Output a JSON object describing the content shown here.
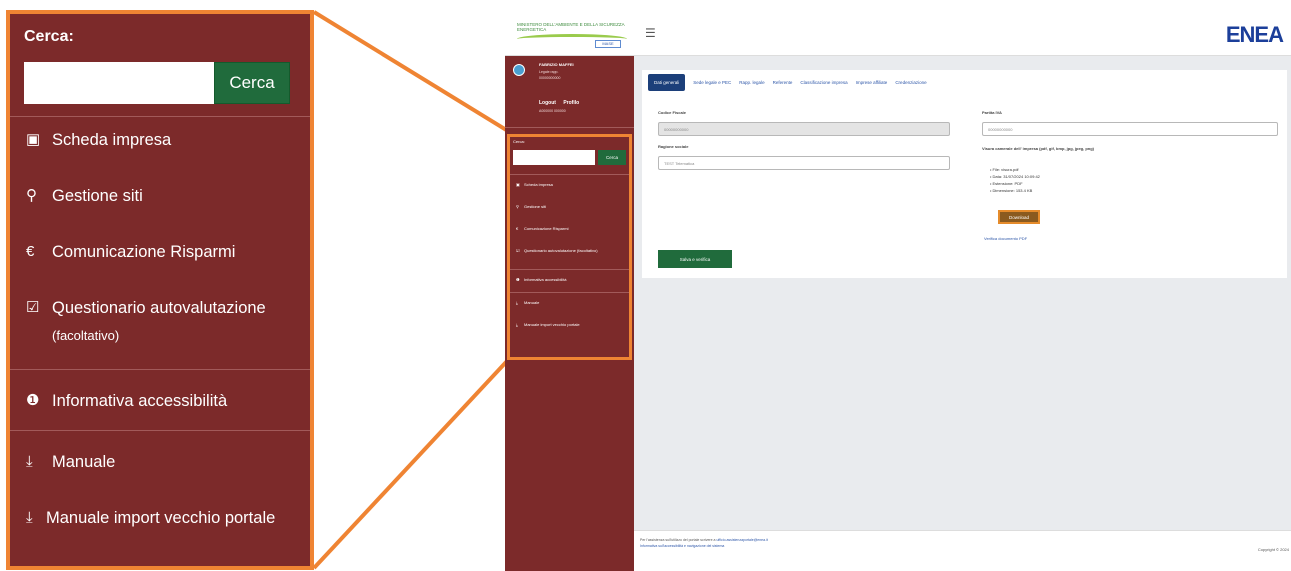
{
  "zoom_menu": {
    "search_label": "Cerca:",
    "search_button": "Cerca",
    "items": [
      {
        "icon": "building-icon",
        "label": "Scheda impresa"
      },
      {
        "icon": "map-marker-icon",
        "label": "Gestione siti"
      },
      {
        "icon": "euro-icon",
        "label": "Comunicazione Risparmi"
      },
      {
        "icon": "checkbox-icon",
        "label": "Questionario autovalutazione",
        "sublabel": "(facoltativo)"
      },
      {
        "icon": "info-circle-icon",
        "label": "Informativa accessibilità"
      },
      {
        "icon": "download-icon",
        "label": "Manuale"
      },
      {
        "icon": "download-icon",
        "label": "Manuale import vecchio portale"
      }
    ]
  },
  "app": {
    "logo_ministry": "MINISTERO DELL'AMBIENTE E DELLA SICUREZZA ENERGETICA",
    "logo_badge": "MASE",
    "logo_enea": "ENEA",
    "user": {
      "name": "FABRIZIO MAFFEI",
      "line1": "Legale rapp.",
      "line2": "00000000000",
      "logout": "Logout",
      "profile": "Profilo",
      "id_line": "A000000 000000"
    },
    "mini_menu": {
      "search_label": "Cerca:",
      "search_button": "Cerca",
      "items": [
        "Scheda impresa",
        "Gestione siti",
        "Comunicazione Risparmi",
        "Questionario autovalutazione (facoltativo)",
        "Informativa accessibilità",
        "Manuale",
        "Manuale import vecchio portale"
      ]
    },
    "tabs": [
      "Dati generali",
      "Sede legale e PEC",
      "Rapp. legale",
      "Referente",
      "Classificazione impresa",
      "Imprese affiliate",
      "Credenziazione"
    ],
    "form": {
      "codice_fiscale_label": "Codice Fiscale",
      "codice_fiscale_value": "00000000000",
      "ragione_sociale_label": "Ragione sociale",
      "ragione_sociale_value": "TEST Telematica",
      "partita_iva_label": "Partita IVA",
      "partita_iva_value": "00000000000",
      "visura_label": "Visura camerale dell' impresa (pdf, gif, bmp, jpg, jpeg, png)",
      "file_info": [
        "File: visura.pdf",
        "Data: 31/07/2024 10:09:42",
        "Estensione: PDF",
        "Dimensione: 153.4 KB"
      ],
      "download_button": "Download",
      "verify_link": "Verifica documento PDF",
      "save_button": "Salva e verifica"
    },
    "footer": {
      "line1": "Per l'assistenza sull'utilizzo del portale scrivere a",
      "email": "ufficio.assistenzaportale@enea.it",
      "line2": "Informativa sull'accessibilità e navigazione del sistema",
      "copyright": "Copyright © 2024"
    }
  }
}
